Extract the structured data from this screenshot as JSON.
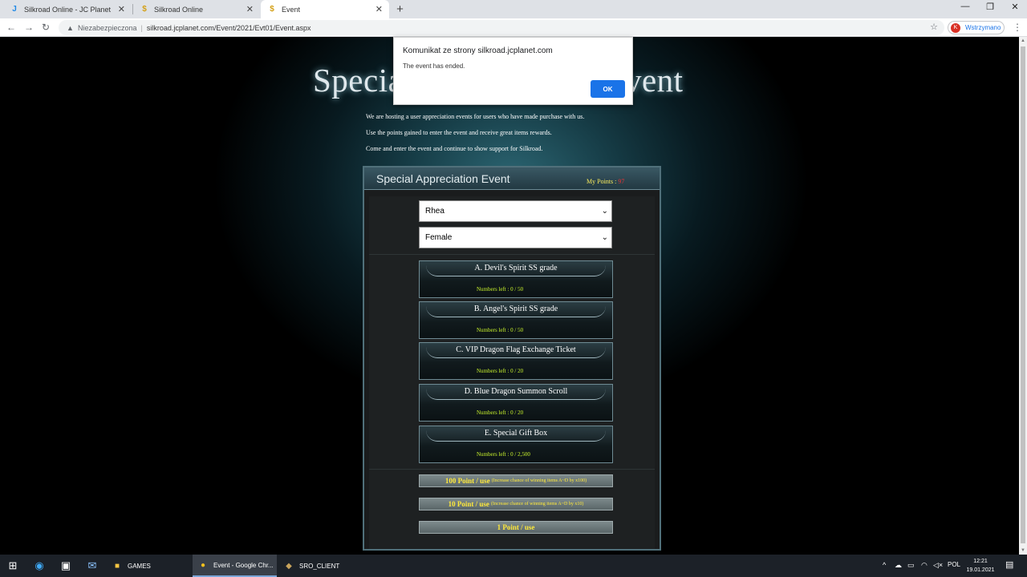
{
  "browser": {
    "tabs": [
      {
        "label": "Silkroad Online - JC Planet"
      },
      {
        "label": "Silkroad Online"
      },
      {
        "label": "Event"
      }
    ],
    "address": {
      "insecure_label": "Niezabezpieczona",
      "url": "silkroad.jcplanet.com/Event/2021/Evt01/Event.aspx"
    },
    "profile": {
      "initial": "K",
      "status": "Wstrzymano"
    }
  },
  "page": {
    "title": "Special Appreciation Event",
    "intro": [
      "We are hosting a user appreciation events for users who have made purchase with us.",
      "Use the points gained to enter the event and receive great items rewards.",
      "Come and enter the event and continue to show support for Silkroad."
    ],
    "panel": {
      "title": "Special Appreciation Event",
      "points_label": "My Points : ",
      "points_value": "97",
      "server_select": "Rhea",
      "gender_select": "Female",
      "items": [
        {
          "name": "A. Devil's Spirit SS grade",
          "numbers_left": "Numbers left : 0 / 50"
        },
        {
          "name": "B. Angel's Spirit SS grade",
          "numbers_left": "Numbers left : 0 / 50"
        },
        {
          "name": "C. VIP Dragon Flag Exchange Ticket",
          "numbers_left": "Numbers left : 0 / 20"
        },
        {
          "name": "D. Blue Dragon Summon Scroll",
          "numbers_left": "Numbers left : 0 / 20"
        },
        {
          "name": "E. Special Gift Box",
          "numbers_left": "Numbers left : 0 / 2,500"
        }
      ],
      "use_buttons": [
        {
          "main": "100 Point / use",
          "note": "(Increase chance of winning items A~D by x100)"
        },
        {
          "main": "10 Point / use",
          "note": "(Increase chance of winning items A~D by x10)"
        },
        {
          "main": "1 Point / use",
          "note": ""
        }
      ]
    }
  },
  "dialog": {
    "title": "Komunikat ze strony silkroad.jcplanet.com",
    "message": "The event has ended.",
    "ok_label": "OK"
  },
  "taskbar": {
    "apps": [
      {
        "label": "GAMES"
      },
      {
        "label": "Event - Google Chr..."
      },
      {
        "label": "SRO_CLIENT"
      }
    ],
    "language": "POL",
    "time": "12:21",
    "date": "19.01.2021"
  },
  "colors": {
    "points_label": "#f7e95b",
    "points_value": "#ee3333",
    "numbers_left": "#c8f22c",
    "use_button_text": "#ffe93b",
    "dialog_ok": "#1a73e8"
  }
}
